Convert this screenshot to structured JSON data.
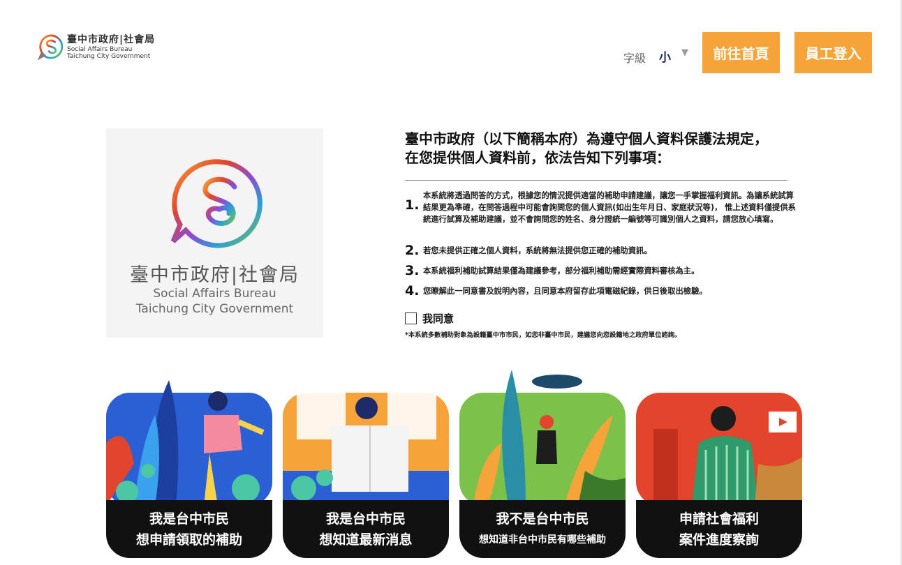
{
  "header": {
    "logo_zh": "臺中市政府|社會局",
    "logo_en_1": "Social Affairs Bureau",
    "logo_en_2": "Taichung City Government",
    "font_size_label": "字級",
    "font_size_value": "小",
    "home_button": "前往首頁",
    "staff_login_button": "員工登入"
  },
  "panel": {
    "zh": "臺中市政府|社會局",
    "en_1": "Social Affairs Bureau",
    "en_2": "Taichung City Government"
  },
  "notice": {
    "title_1": "臺中市政府（以下簡稱本府）為遵守個人資料保護法規定，",
    "title_2": "在您提供個人資料前，依法告知下列事項：",
    "items": [
      {
        "num": "1.",
        "text": "本系統將透過問答的方式，根據您的情況提供適當的補助申請建議，讓您一手掌握福利資訊。為讓系統試算結果更為準確，在問答過程中可能會詢問您的個人資訊(如出生年月日、家庭狀況等)， 惟上述資料僅提供系統進行試算及補助建議，並不會詢問您的姓名、身分證統一編號等可識別個人之資料，請您放心填寫。"
      },
      {
        "num": "2.",
        "text": "若您未提供正確之個人資料，系統將無法提供您正確的補助資訊。"
      },
      {
        "num": "3.",
        "text": "本系統福利補助試算結果僅為建議參考，部分福利補助需經實際資料審核為主。"
      },
      {
        "num": "4.",
        "text": "您瞭解此一同意書及說明內容，且同意本府留存此項電磁紀錄，供日後取出檢驗。"
      }
    ],
    "agree_label": "我同意",
    "footnote": "*本系統多數補助對象為設籍臺中市市民，如您非臺中市民，建議您向您設籍地之政府單位諮詢。"
  },
  "cards": [
    {
      "line1": "我是台中市民",
      "line2": "想申請領取的補助",
      "bg": "#2a5fd6"
    },
    {
      "line1": "我是台中市民",
      "line2": "想知道最新消息",
      "bg": "#f6a43a"
    },
    {
      "line1": "我不是台中市民",
      "line2": "想知道非台中市民有哪些補助",
      "bg": "#7cc24a"
    },
    {
      "line1": "申請社會福利",
      "line2": "案件進度察詢",
      "bg": "#e2452b"
    }
  ],
  "colors": {
    "accent": "#f6a43a",
    "dark_bar": "#111111"
  }
}
